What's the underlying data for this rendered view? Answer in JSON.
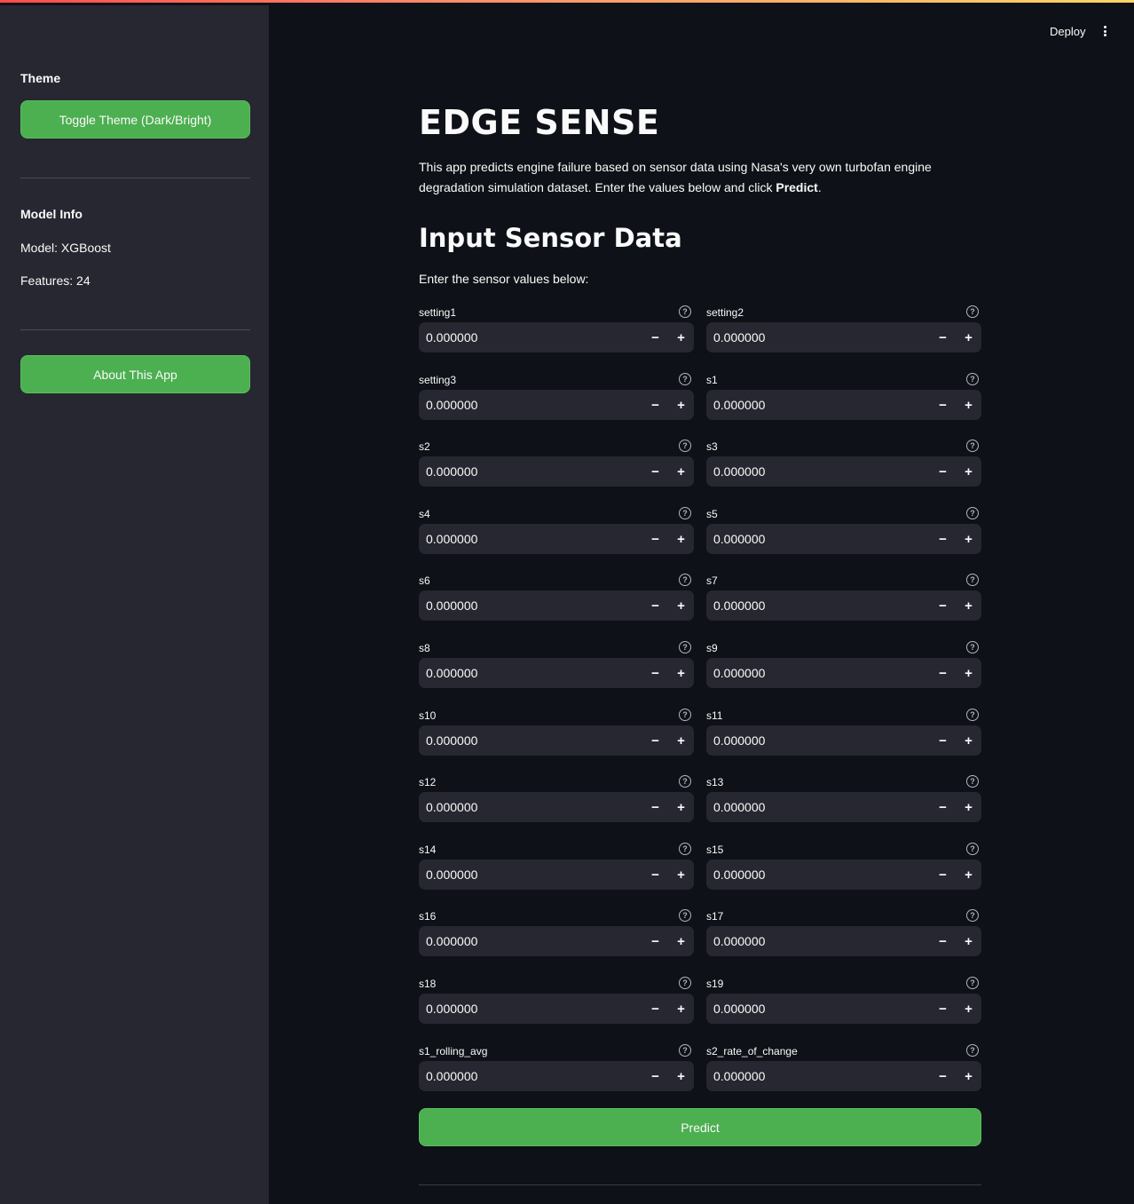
{
  "header": {
    "deploy_label": "Deploy",
    "menu_icon": "kebab-menu-icon"
  },
  "sidebar": {
    "theme_heading": "Theme",
    "toggle_theme_label": "Toggle Theme (Dark/Bright)",
    "model_info_heading": "Model Info",
    "model_text": "Model: XGBoost",
    "features_text": "Features: 24",
    "about_label": "About This App"
  },
  "main": {
    "title": "EDGE SENSE",
    "description_pre": "This app predicts engine failure based on sensor data using Nasa's very own turbofan engine degradation simulation dataset. Enter the values below and click ",
    "description_bold": "Predict",
    "description_post": ".",
    "subtitle": "Input Sensor Data",
    "instructions": "Enter the sensor values below:",
    "predict_label": "Predict"
  },
  "fields": [
    {
      "label": "setting1",
      "value": "0.000000"
    },
    {
      "label": "setting2",
      "value": "0.000000"
    },
    {
      "label": "setting3",
      "value": "0.000000"
    },
    {
      "label": "s1",
      "value": "0.000000"
    },
    {
      "label": "s2",
      "value": "0.000000"
    },
    {
      "label": "s3",
      "value": "0.000000"
    },
    {
      "label": "s4",
      "value": "0.000000"
    },
    {
      "label": "s5",
      "value": "0.000000"
    },
    {
      "label": "s6",
      "value": "0.000000"
    },
    {
      "label": "s7",
      "value": "0.000000"
    },
    {
      "label": "s8",
      "value": "0.000000"
    },
    {
      "label": "s9",
      "value": "0.000000"
    },
    {
      "label": "s10",
      "value": "0.000000"
    },
    {
      "label": "s11",
      "value": "0.000000"
    },
    {
      "label": "s12",
      "value": "0.000000"
    },
    {
      "label": "s13",
      "value": "0.000000"
    },
    {
      "label": "s14",
      "value": "0.000000"
    },
    {
      "label": "s15",
      "value": "0.000000"
    },
    {
      "label": "s16",
      "value": "0.000000"
    },
    {
      "label": "s17",
      "value": "0.000000"
    },
    {
      "label": "s18",
      "value": "0.000000"
    },
    {
      "label": "s19",
      "value": "0.000000"
    },
    {
      "label": "s1_rolling_avg",
      "value": "0.000000"
    },
    {
      "label": "s2_rate_of_change",
      "value": "0.000000"
    }
  ],
  "stepper": {
    "minus": "−",
    "plus": "+",
    "help": "?"
  },
  "colors": {
    "accent_green": "#4caf50",
    "sidebar_bg": "#262730",
    "main_bg": "#0e1117"
  }
}
